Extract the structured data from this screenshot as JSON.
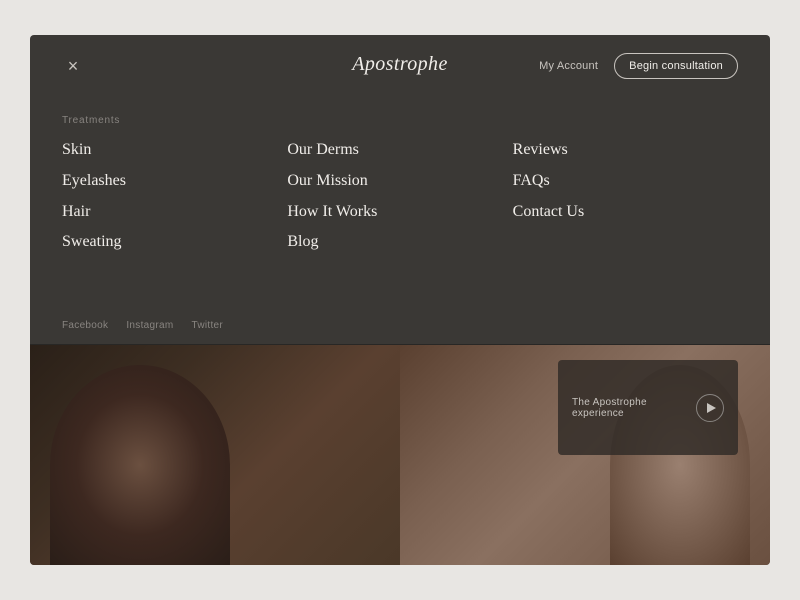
{
  "header": {
    "logo": "Apostrophe",
    "my_account": "My Account",
    "begin_consultation": "Begin consultation",
    "close_icon": "×"
  },
  "nav": {
    "treatments_label": "Treatments",
    "columns": [
      {
        "items": [
          "Skin",
          "Eyelashes",
          "Hair",
          "Sweating"
        ]
      },
      {
        "items": [
          "Our Derms",
          "Our Mission",
          "How It Works",
          "Blog"
        ]
      },
      {
        "items": [
          "Reviews",
          "FAQs",
          "Contact Us"
        ]
      }
    ]
  },
  "social": {
    "links": [
      "Facebook",
      "Instagram",
      "Twitter"
    ]
  },
  "video": {
    "text": "The Apostrophe experience",
    "play_label": "Play"
  }
}
